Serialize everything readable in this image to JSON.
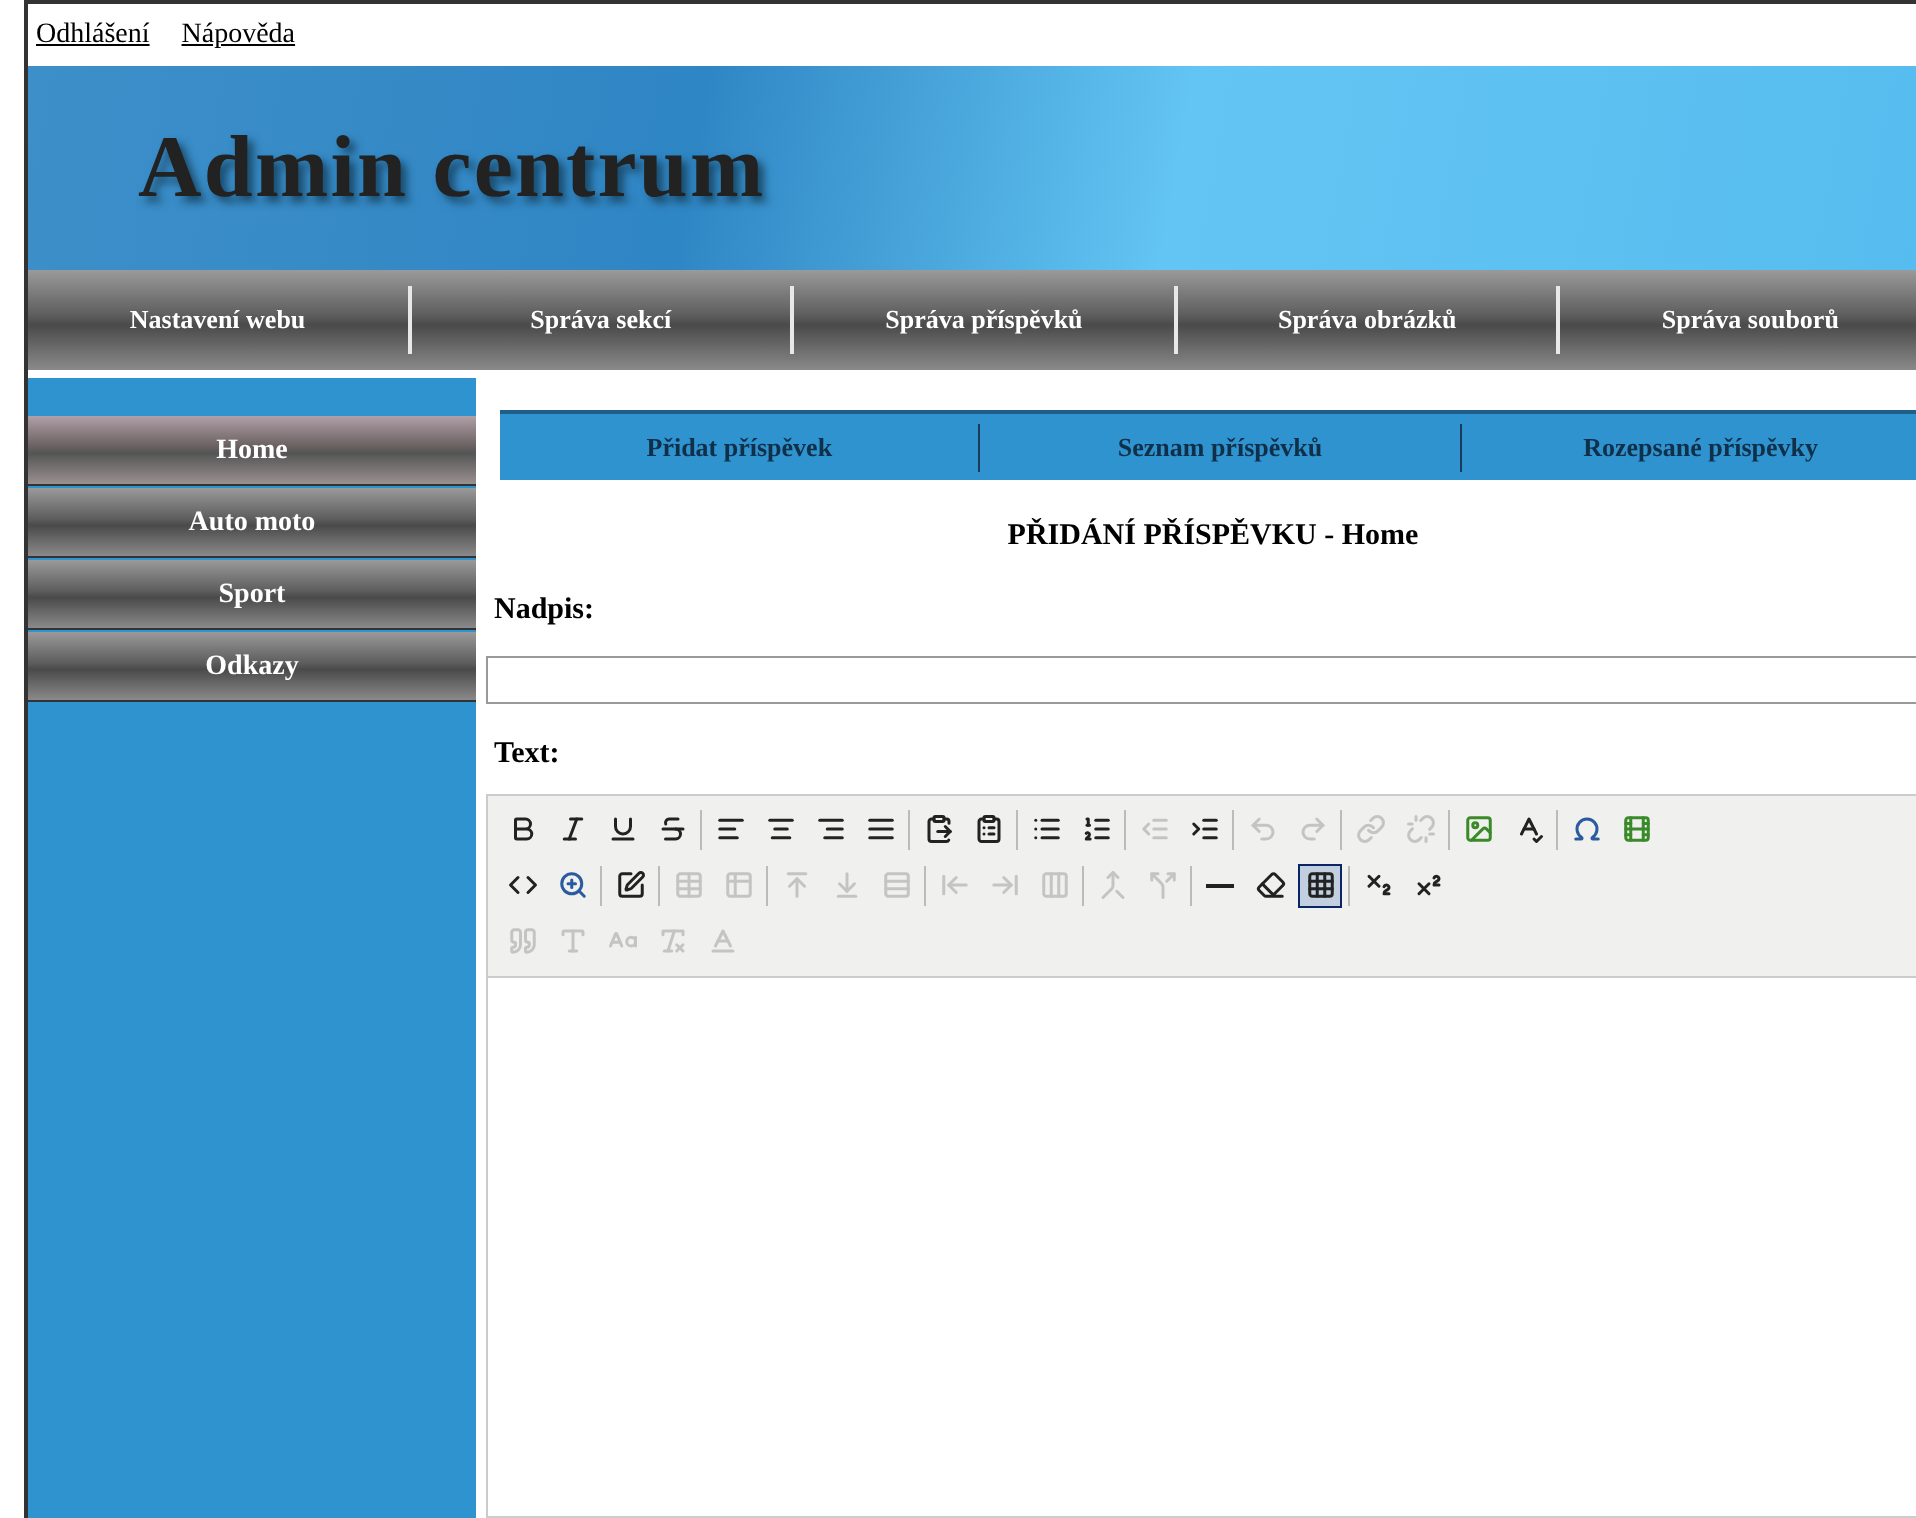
{
  "top_links": [
    "Odhlášení",
    "Nápověda"
  ],
  "header": {
    "title": "Admin centrum"
  },
  "main_nav": [
    "Nastavení webu",
    "Správa sekcí",
    "Správa příspěvků",
    "Správa obrázků",
    "Správa souborů"
  ],
  "sidebar": {
    "items": [
      {
        "label": "Home",
        "selected": true
      },
      {
        "label": "Auto moto",
        "selected": false
      },
      {
        "label": "Sport",
        "selected": false
      },
      {
        "label": "Odkazy",
        "selected": false
      }
    ]
  },
  "sub_tabs": [
    "Přidat příspěvek",
    "Seznam příspěvků",
    "Rozepsané příspěvky"
  ],
  "heading": "PŘIDÁNÍ PŘÍSPĚVKU - Home",
  "title_field": {
    "label": "Nadpis:"
  },
  "text_label": "Text:",
  "toolbar": [
    [
      {
        "kind": "bold",
        "disabled": false,
        "selected": false
      },
      {
        "kind": "italic",
        "disabled": false,
        "selected": false
      },
      {
        "kind": "underline",
        "disabled": false,
        "selected": false
      },
      {
        "kind": "strike",
        "disabled": false,
        "selected": false
      },
      {
        "kind": "sep"
      },
      {
        "kind": "align-left",
        "disabled": false,
        "selected": false
      },
      {
        "kind": "align-center",
        "disabled": false,
        "selected": false
      },
      {
        "kind": "align-right",
        "disabled": false,
        "selected": false
      },
      {
        "kind": "align-justify",
        "disabled": false,
        "selected": false
      },
      {
        "kind": "sep"
      },
      {
        "kind": "paste",
        "disabled": false,
        "selected": false
      },
      {
        "kind": "paste-word",
        "disabled": false,
        "selected": false
      },
      {
        "kind": "sep"
      },
      {
        "kind": "bullets",
        "disabled": false,
        "selected": false
      },
      {
        "kind": "numbers",
        "disabled": false,
        "selected": false
      },
      {
        "kind": "sep"
      },
      {
        "kind": "outdent",
        "disabled": true,
        "selected": false
      },
      {
        "kind": "indent",
        "disabled": false,
        "selected": false
      },
      {
        "kind": "sep"
      },
      {
        "kind": "undo",
        "disabled": true,
        "selected": false
      },
      {
        "kind": "redo",
        "disabled": true,
        "selected": false
      },
      {
        "kind": "sep"
      },
      {
        "kind": "link",
        "disabled": true,
        "selected": false
      },
      {
        "kind": "unlink",
        "disabled": true,
        "selected": false
      },
      {
        "kind": "sep"
      },
      {
        "kind": "image",
        "disabled": false,
        "selected": false
      },
      {
        "kind": "spellcheck",
        "disabled": false,
        "selected": false
      },
      {
        "kind": "sep"
      },
      {
        "kind": "omega",
        "disabled": false,
        "selected": false
      },
      {
        "kind": "media",
        "disabled": false,
        "selected": false
      }
    ],
    [
      {
        "kind": "html",
        "disabled": false,
        "selected": false
      },
      {
        "kind": "zoom",
        "disabled": false,
        "selected": false
      },
      {
        "kind": "sep"
      },
      {
        "kind": "edit",
        "disabled": false,
        "selected": false
      },
      {
        "kind": "sep"
      },
      {
        "kind": "table",
        "disabled": true,
        "selected": false
      },
      {
        "kind": "table-props",
        "disabled": true,
        "selected": false
      },
      {
        "kind": "sep"
      },
      {
        "kind": "row-before",
        "disabled": true,
        "selected": false
      },
      {
        "kind": "row-after",
        "disabled": true,
        "selected": false
      },
      {
        "kind": "row-delete",
        "disabled": true,
        "selected": false
      },
      {
        "kind": "sep"
      },
      {
        "kind": "col-before",
        "disabled": true,
        "selected": false
      },
      {
        "kind": "col-after",
        "disabled": true,
        "selected": false
      },
      {
        "kind": "col-delete",
        "disabled": true,
        "selected": false
      },
      {
        "kind": "sep"
      },
      {
        "kind": "merge",
        "disabled": true,
        "selected": false
      },
      {
        "kind": "split",
        "disabled": true,
        "selected": false
      },
      {
        "kind": "sep"
      },
      {
        "kind": "hr",
        "disabled": false,
        "selected": false
      },
      {
        "kind": "eraser",
        "disabled": false,
        "selected": false
      },
      {
        "kind": "visual-aid",
        "disabled": false,
        "selected": true
      },
      {
        "kind": "sep"
      },
      {
        "kind": "subscript",
        "disabled": false,
        "selected": false
      },
      {
        "kind": "superscript",
        "disabled": false,
        "selected": false
      }
    ],
    [
      {
        "kind": "quote",
        "disabled": true,
        "selected": false
      },
      {
        "kind": "abbr",
        "disabled": true,
        "selected": false
      },
      {
        "kind": "acronym",
        "disabled": true,
        "selected": false
      },
      {
        "kind": "del",
        "disabled": true,
        "selected": false
      },
      {
        "kind": "ins",
        "disabled": true,
        "selected": false
      }
    ]
  ]
}
